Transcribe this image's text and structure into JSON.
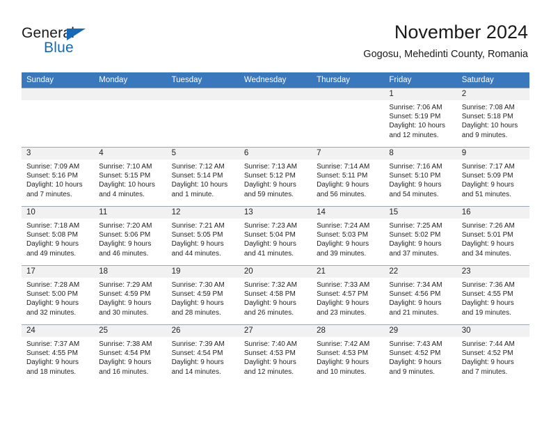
{
  "brand": {
    "name_top": "General",
    "name_bottom": "Blue",
    "triangle_color": "#1569bb"
  },
  "header": {
    "title": "November 2024",
    "subtitle": "Gogosu, Mehedinti County, Romania"
  },
  "theme": {
    "header_row_bg": "#3a78bd",
    "daynum_bg": "#f1f1f1",
    "grid_line": "#9aa7b4",
    "text": "#222222"
  },
  "weekday_headers": [
    "Sunday",
    "Monday",
    "Tuesday",
    "Wednesday",
    "Thursday",
    "Friday",
    "Saturday"
  ],
  "labels": {
    "sunrise": "Sunrise:",
    "sunset": "Sunset:",
    "daylight": "Daylight:"
  },
  "weeks": [
    [
      {
        "day": "",
        "sunrise": "",
        "sunset": "",
        "daylight_line1": "",
        "daylight_line2": ""
      },
      {
        "day": "",
        "sunrise": "",
        "sunset": "",
        "daylight_line1": "",
        "daylight_line2": ""
      },
      {
        "day": "",
        "sunrise": "",
        "sunset": "",
        "daylight_line1": "",
        "daylight_line2": ""
      },
      {
        "day": "",
        "sunrise": "",
        "sunset": "",
        "daylight_line1": "",
        "daylight_line2": ""
      },
      {
        "day": "",
        "sunrise": "",
        "sunset": "",
        "daylight_line1": "",
        "daylight_line2": ""
      },
      {
        "day": "1",
        "sunrise": "Sunrise: 7:06 AM",
        "sunset": "Sunset: 5:19 PM",
        "daylight_line1": "Daylight: 10 hours",
        "daylight_line2": "and 12 minutes."
      },
      {
        "day": "2",
        "sunrise": "Sunrise: 7:08 AM",
        "sunset": "Sunset: 5:18 PM",
        "daylight_line1": "Daylight: 10 hours",
        "daylight_line2": "and 9 minutes."
      }
    ],
    [
      {
        "day": "3",
        "sunrise": "Sunrise: 7:09 AM",
        "sunset": "Sunset: 5:16 PM",
        "daylight_line1": "Daylight: 10 hours",
        "daylight_line2": "and 7 minutes."
      },
      {
        "day": "4",
        "sunrise": "Sunrise: 7:10 AM",
        "sunset": "Sunset: 5:15 PM",
        "daylight_line1": "Daylight: 10 hours",
        "daylight_line2": "and 4 minutes."
      },
      {
        "day": "5",
        "sunrise": "Sunrise: 7:12 AM",
        "sunset": "Sunset: 5:14 PM",
        "daylight_line1": "Daylight: 10 hours",
        "daylight_line2": "and 1 minute."
      },
      {
        "day": "6",
        "sunrise": "Sunrise: 7:13 AM",
        "sunset": "Sunset: 5:12 PM",
        "daylight_line1": "Daylight: 9 hours",
        "daylight_line2": "and 59 minutes."
      },
      {
        "day": "7",
        "sunrise": "Sunrise: 7:14 AM",
        "sunset": "Sunset: 5:11 PM",
        "daylight_line1": "Daylight: 9 hours",
        "daylight_line2": "and 56 minutes."
      },
      {
        "day": "8",
        "sunrise": "Sunrise: 7:16 AM",
        "sunset": "Sunset: 5:10 PM",
        "daylight_line1": "Daylight: 9 hours",
        "daylight_line2": "and 54 minutes."
      },
      {
        "day": "9",
        "sunrise": "Sunrise: 7:17 AM",
        "sunset": "Sunset: 5:09 PM",
        "daylight_line1": "Daylight: 9 hours",
        "daylight_line2": "and 51 minutes."
      }
    ],
    [
      {
        "day": "10",
        "sunrise": "Sunrise: 7:18 AM",
        "sunset": "Sunset: 5:08 PM",
        "daylight_line1": "Daylight: 9 hours",
        "daylight_line2": "and 49 minutes."
      },
      {
        "day": "11",
        "sunrise": "Sunrise: 7:20 AM",
        "sunset": "Sunset: 5:06 PM",
        "daylight_line1": "Daylight: 9 hours",
        "daylight_line2": "and 46 minutes."
      },
      {
        "day": "12",
        "sunrise": "Sunrise: 7:21 AM",
        "sunset": "Sunset: 5:05 PM",
        "daylight_line1": "Daylight: 9 hours",
        "daylight_line2": "and 44 minutes."
      },
      {
        "day": "13",
        "sunrise": "Sunrise: 7:23 AM",
        "sunset": "Sunset: 5:04 PM",
        "daylight_line1": "Daylight: 9 hours",
        "daylight_line2": "and 41 minutes."
      },
      {
        "day": "14",
        "sunrise": "Sunrise: 7:24 AM",
        "sunset": "Sunset: 5:03 PM",
        "daylight_line1": "Daylight: 9 hours",
        "daylight_line2": "and 39 minutes."
      },
      {
        "day": "15",
        "sunrise": "Sunrise: 7:25 AM",
        "sunset": "Sunset: 5:02 PM",
        "daylight_line1": "Daylight: 9 hours",
        "daylight_line2": "and 37 minutes."
      },
      {
        "day": "16",
        "sunrise": "Sunrise: 7:26 AM",
        "sunset": "Sunset: 5:01 PM",
        "daylight_line1": "Daylight: 9 hours",
        "daylight_line2": "and 34 minutes."
      }
    ],
    [
      {
        "day": "17",
        "sunrise": "Sunrise: 7:28 AM",
        "sunset": "Sunset: 5:00 PM",
        "daylight_line1": "Daylight: 9 hours",
        "daylight_line2": "and 32 minutes."
      },
      {
        "day": "18",
        "sunrise": "Sunrise: 7:29 AM",
        "sunset": "Sunset: 4:59 PM",
        "daylight_line1": "Daylight: 9 hours",
        "daylight_line2": "and 30 minutes."
      },
      {
        "day": "19",
        "sunrise": "Sunrise: 7:30 AM",
        "sunset": "Sunset: 4:59 PM",
        "daylight_line1": "Daylight: 9 hours",
        "daylight_line2": "and 28 minutes."
      },
      {
        "day": "20",
        "sunrise": "Sunrise: 7:32 AM",
        "sunset": "Sunset: 4:58 PM",
        "daylight_line1": "Daylight: 9 hours",
        "daylight_line2": "and 26 minutes."
      },
      {
        "day": "21",
        "sunrise": "Sunrise: 7:33 AM",
        "sunset": "Sunset: 4:57 PM",
        "daylight_line1": "Daylight: 9 hours",
        "daylight_line2": "and 23 minutes."
      },
      {
        "day": "22",
        "sunrise": "Sunrise: 7:34 AM",
        "sunset": "Sunset: 4:56 PM",
        "daylight_line1": "Daylight: 9 hours",
        "daylight_line2": "and 21 minutes."
      },
      {
        "day": "23",
        "sunrise": "Sunrise: 7:36 AM",
        "sunset": "Sunset: 4:55 PM",
        "daylight_line1": "Daylight: 9 hours",
        "daylight_line2": "and 19 minutes."
      }
    ],
    [
      {
        "day": "24",
        "sunrise": "Sunrise: 7:37 AM",
        "sunset": "Sunset: 4:55 PM",
        "daylight_line1": "Daylight: 9 hours",
        "daylight_line2": "and 18 minutes."
      },
      {
        "day": "25",
        "sunrise": "Sunrise: 7:38 AM",
        "sunset": "Sunset: 4:54 PM",
        "daylight_line1": "Daylight: 9 hours",
        "daylight_line2": "and 16 minutes."
      },
      {
        "day": "26",
        "sunrise": "Sunrise: 7:39 AM",
        "sunset": "Sunset: 4:54 PM",
        "daylight_line1": "Daylight: 9 hours",
        "daylight_line2": "and 14 minutes."
      },
      {
        "day": "27",
        "sunrise": "Sunrise: 7:40 AM",
        "sunset": "Sunset: 4:53 PM",
        "daylight_line1": "Daylight: 9 hours",
        "daylight_line2": "and 12 minutes."
      },
      {
        "day": "28",
        "sunrise": "Sunrise: 7:42 AM",
        "sunset": "Sunset: 4:53 PM",
        "daylight_line1": "Daylight: 9 hours",
        "daylight_line2": "and 10 minutes."
      },
      {
        "day": "29",
        "sunrise": "Sunrise: 7:43 AM",
        "sunset": "Sunset: 4:52 PM",
        "daylight_line1": "Daylight: 9 hours",
        "daylight_line2": "and 9 minutes."
      },
      {
        "day": "30",
        "sunrise": "Sunrise: 7:44 AM",
        "sunset": "Sunset: 4:52 PM",
        "daylight_line1": "Daylight: 9 hours",
        "daylight_line2": "and 7 minutes."
      }
    ]
  ]
}
